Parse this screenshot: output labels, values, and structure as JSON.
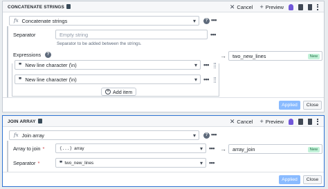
{
  "board1": {
    "title": "CONCATENATE STRINGS",
    "actions": {
      "cancel": "Cancel",
      "preview": "Preview"
    },
    "function": {
      "value": "Concatenate strings"
    },
    "separator": {
      "label": "Separator",
      "placeholder": "Empty string",
      "hint": "Separator to be added between the strings."
    },
    "expressions": {
      "label": "Expressions",
      "items": [
        {
          "value": "New line character (\\n)"
        },
        {
          "value": "New line character (\\n)"
        }
      ],
      "add_item": "Add item"
    },
    "output": {
      "value": "two_new_lines",
      "badge": "New"
    },
    "footer": {
      "applied": "Applied",
      "close": "Close"
    }
  },
  "board2": {
    "title": "JOIN ARRAY",
    "actions": {
      "cancel": "Cancel",
      "preview": "Preview"
    },
    "function": {
      "value": "Join array"
    },
    "array_to_join": {
      "label": "Array to join",
      "value": "array",
      "type_icon": "{...}"
    },
    "separator": {
      "label": "Separator",
      "value": "two_new_lines"
    },
    "output": {
      "value": "array_join",
      "badge": "New"
    },
    "footer": {
      "applied": "Applied",
      "close": "Close"
    }
  },
  "colors": {
    "accent": "#2d72d2",
    "applied_bg": "#8abbff",
    "badge_bg": "#c3f2d9",
    "required": "#cd4246",
    "idea": "#7157d9"
  }
}
